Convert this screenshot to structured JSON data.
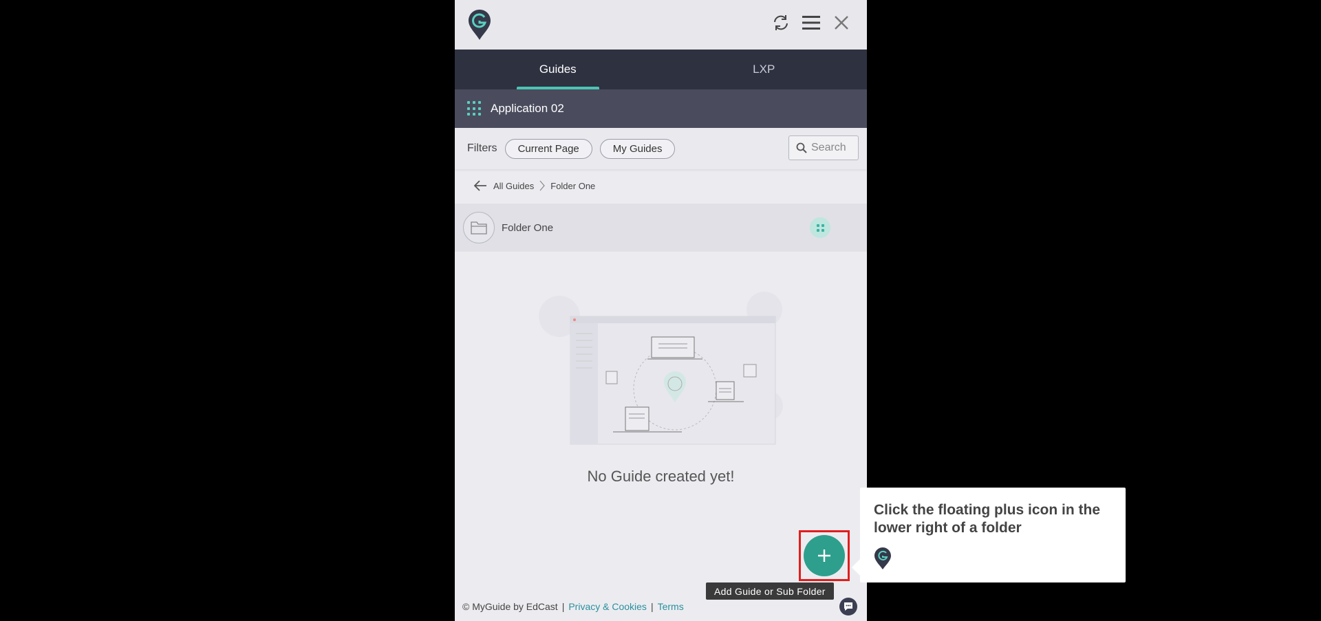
{
  "tabs": [
    {
      "label": "Guides",
      "active": true
    },
    {
      "label": "LXP",
      "active": false
    }
  ],
  "app": {
    "name": "Application 02"
  },
  "filters": {
    "label": "Filters",
    "chips": [
      "Current Page",
      "My Guides"
    ],
    "search_placeholder": "Search"
  },
  "breadcrumb": {
    "root": "All Guides",
    "current": "Folder One"
  },
  "folder": {
    "name": "Folder One"
  },
  "empty_state": {
    "message": "No Guide created yet!"
  },
  "fab": {
    "tooltip": "Add Guide or Sub Folder"
  },
  "footer": {
    "copyright": "© MyGuide by EdCast",
    "privacy": "Privacy & Cookies",
    "terms": "Terms"
  },
  "callout": {
    "text": "Click the floating plus icon in the lower right of a folder"
  },
  "colors": {
    "accent": "#2e9f8d",
    "tab_bar": "#2e3140",
    "app_bar": "#4a4c5e",
    "highlight": "#e21d1d",
    "link": "#2a8f9e"
  }
}
